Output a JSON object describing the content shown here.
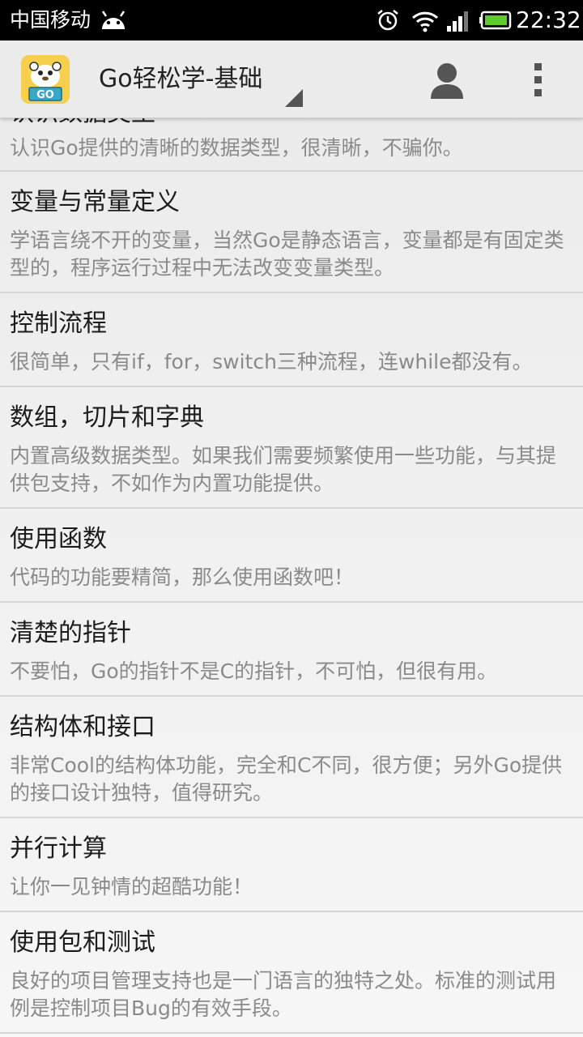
{
  "status_bar": {
    "carrier": "中国移动",
    "time": "22:32",
    "battery_color": "#5ccc2c"
  },
  "action_bar": {
    "title": "Go轻松学-基础",
    "logo_text": "GO"
  },
  "list": {
    "items": [
      {
        "title": "认识数据类型",
        "desc": "认识Go提供的清晰的数据类型，很清晰，不骗你。"
      },
      {
        "title": "变量与常量定义",
        "desc": "学语言绕不开的变量，当然Go是静态语言，变量都是有固定类型的，程序运行过程中无法改变变量类型。"
      },
      {
        "title": "控制流程",
        "desc": "很简单，只有if，for，switch三种流程，连while都没有。"
      },
      {
        "title": "数组，切片和字典",
        "desc": "内置高级数据类型。如果我们需要频繁使用一些功能，与其提供包支持，不如作为内置功能提供。"
      },
      {
        "title": "使用函数",
        "desc": "代码的功能要精简，那么使用函数吧！"
      },
      {
        "title": "清楚的指针",
        "desc": "不要怕，Go的指针不是C的指针，不可怕，但很有用。"
      },
      {
        "title": "结构体和接口",
        "desc": "非常Cool的结构体功能，完全和C不同，很方便；另外Go提供的接口设计独特，值得研究。"
      },
      {
        "title": "并行计算",
        "desc": "让你一见钟情的超酷功能！"
      },
      {
        "title": "使用包和测试",
        "desc": "良好的项目管理支持也是一门语言的独特之处。标准的测试用例是控制项目Bug的有效手段。"
      }
    ]
  }
}
